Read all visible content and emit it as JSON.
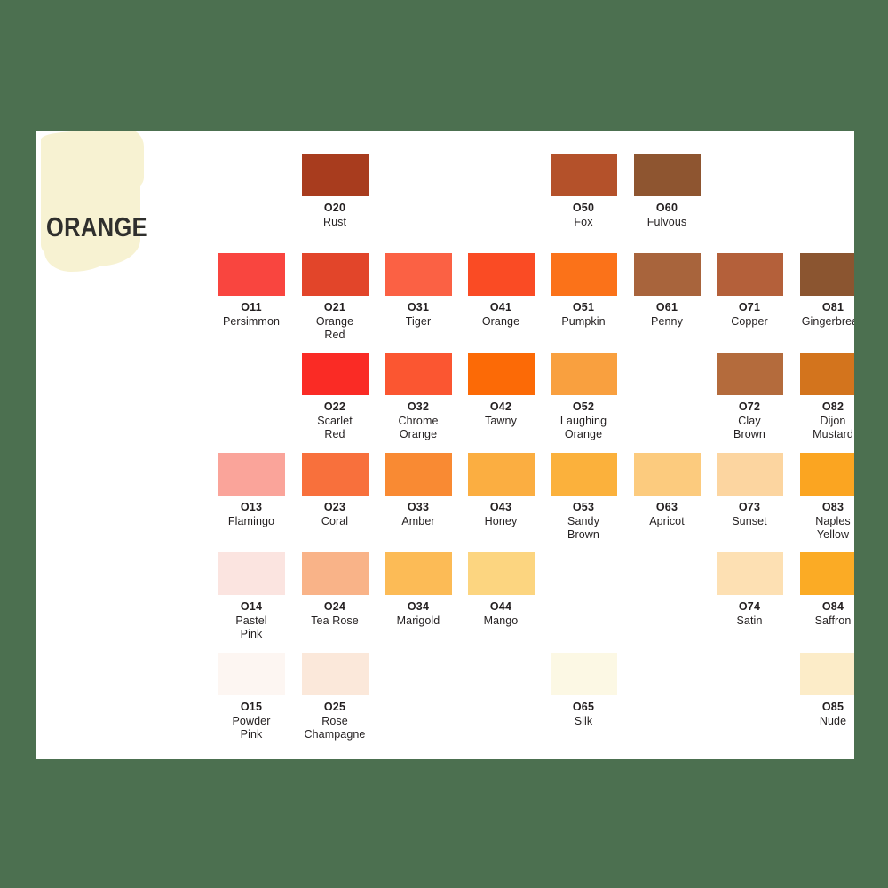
{
  "background_color": "#4c7050",
  "card_background": "#ffffff",
  "paint_stroke_color": "#f7f2d2",
  "title": "ORANGE",
  "title_color": "#2f2f2d",
  "text_color": "#231f20",
  "layout": {
    "columns": 8,
    "rows": 6,
    "column_x": [
      206,
      300,
      394,
      487,
      580,
      674,
      767,
      861
    ],
    "row_y": [
      25,
      137,
      249,
      362,
      474,
      587
    ],
    "swatch_width": 75,
    "swatch_height": 48
  },
  "swatches": [
    {
      "code": "O20",
      "name": "Rust",
      "hex": "#a83c1e",
      "col": 1,
      "row": 0
    },
    {
      "code": "O50",
      "name": "Fox",
      "hex": "#b4512a",
      "col": 4,
      "row": 0
    },
    {
      "code": "O60",
      "name": "Fulvous",
      "hex": "#8e5530",
      "col": 5,
      "row": 0
    },
    {
      "code": "O11",
      "name": "Persimmon",
      "hex": "#f9453f",
      "col": 0,
      "row": 1
    },
    {
      "code": "O21",
      "name": "Orange\nRed",
      "hex": "#e2452a",
      "col": 1,
      "row": 1
    },
    {
      "code": "O31",
      "name": "Tiger",
      "hex": "#fb6144",
      "col": 2,
      "row": 1
    },
    {
      "code": "O41",
      "name": "Orange",
      "hex": "#fa4b24",
      "col": 3,
      "row": 1
    },
    {
      "code": "O51",
      "name": "Pumpkin",
      "hex": "#fb7219",
      "col": 4,
      "row": 1
    },
    {
      "code": "O61",
      "name": "Penny",
      "hex": "#a8643c",
      "col": 5,
      "row": 1
    },
    {
      "code": "O71",
      "name": "Copper",
      "hex": "#b4603a",
      "col": 6,
      "row": 1
    },
    {
      "code": "O81",
      "name": "Gingerbread",
      "hex": "#8b5530",
      "col": 7,
      "row": 1
    },
    {
      "code": "O22",
      "name": "Scarlet\nRed",
      "hex": "#fa2b25",
      "col": 1,
      "row": 2
    },
    {
      "code": "O32",
      "name": "Chrome\nOrange",
      "hex": "#fb5631",
      "col": 2,
      "row": 2
    },
    {
      "code": "O42",
      "name": "Tawny",
      "hex": "#fc6a06",
      "col": 3,
      "row": 2
    },
    {
      "code": "O52",
      "name": "Laughing\nOrange",
      "hex": "#f9a03f",
      "col": 4,
      "row": 2
    },
    {
      "code": "O72",
      "name": "Clay\nBrown",
      "hex": "#b46b3c",
      "col": 6,
      "row": 2
    },
    {
      "code": "O82",
      "name": "Dijon\nMustard",
      "hex": "#d3741d",
      "col": 7,
      "row": 2
    },
    {
      "code": "O13",
      "name": "Flamingo",
      "hex": "#faa49a",
      "col": 0,
      "row": 3
    },
    {
      "code": "O23",
      "name": "Coral",
      "hex": "#f8703c",
      "col": 1,
      "row": 3
    },
    {
      "code": "O33",
      "name": "Amber",
      "hex": "#f98a33",
      "col": 2,
      "row": 3
    },
    {
      "code": "O43",
      "name": "Honey",
      "hex": "#fbae41",
      "col": 3,
      "row": 3
    },
    {
      "code": "O53",
      "name": "Sandy\nBrown",
      "hex": "#fbb13c",
      "col": 4,
      "row": 3
    },
    {
      "code": "O63",
      "name": "Apricot",
      "hex": "#fccb7e",
      "col": 5,
      "row": 3
    },
    {
      "code": "O73",
      "name": "Sunset",
      "hex": "#fcd5a0",
      "col": 6,
      "row": 3
    },
    {
      "code": "O83",
      "name": "Naples\nYellow",
      "hex": "#fba521",
      "col": 7,
      "row": 3
    },
    {
      "code": "O14",
      "name": "Pastel\nPink",
      "hex": "#fbe4e0",
      "col": 0,
      "row": 4
    },
    {
      "code": "O24",
      "name": "Tea Rose",
      "hex": "#f9b388",
      "col": 1,
      "row": 4
    },
    {
      "code": "O34",
      "name": "Marigold",
      "hex": "#fcbb56",
      "col": 2,
      "row": 4
    },
    {
      "code": "O44",
      "name": "Mango",
      "hex": "#fcd580",
      "col": 3,
      "row": 4
    },
    {
      "code": "O74",
      "name": "Satin",
      "hex": "#fde0b3",
      "col": 6,
      "row": 4
    },
    {
      "code": "O84",
      "name": "Saffron",
      "hex": "#fbab25",
      "col": 7,
      "row": 4
    },
    {
      "code": "O15",
      "name": "Powder\nPink",
      "hex": "#fdf6f2",
      "col": 0,
      "row": 5
    },
    {
      "code": "O25",
      "name": "Rose\nChampagne",
      "hex": "#fbe8da",
      "col": 1,
      "row": 5
    },
    {
      "code": "O65",
      "name": "Silk",
      "hex": "#fcf8e4",
      "col": 4,
      "row": 5
    },
    {
      "code": "O85",
      "name": "Nude",
      "hex": "#fcecc8",
      "col": 7,
      "row": 5
    }
  ]
}
